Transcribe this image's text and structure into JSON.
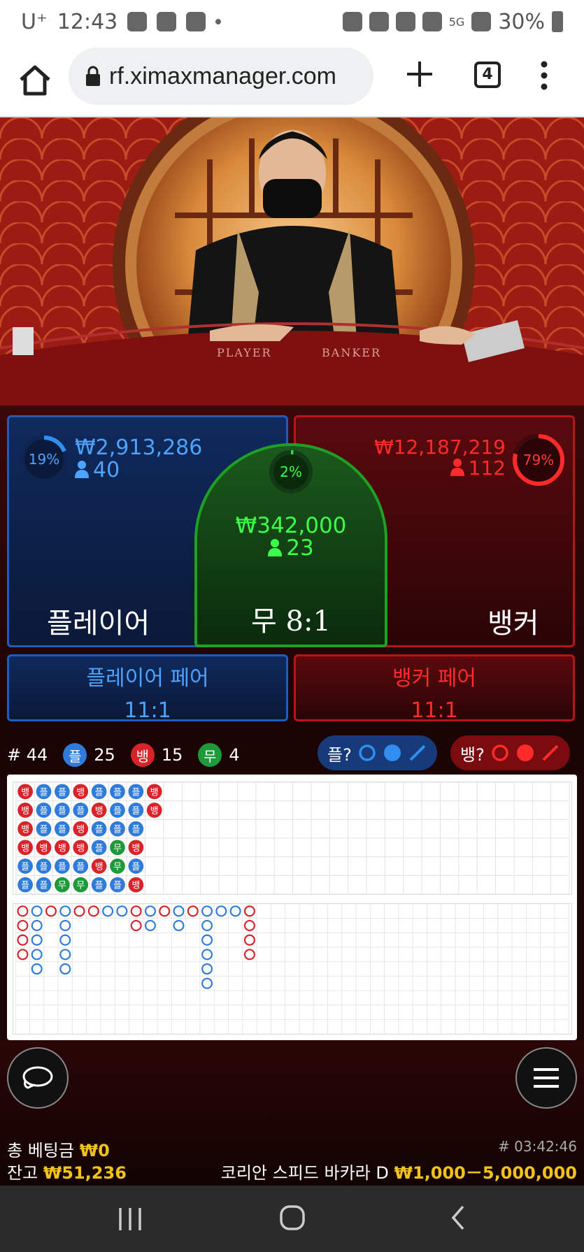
{
  "status_bar": {
    "carrier": "U⁺",
    "time": "12:43",
    "network": "5G",
    "battery": "30%"
  },
  "browser": {
    "url": "rf.ximaxmanager.com",
    "tab_count": "4"
  },
  "video": {
    "table_labels": [
      "PLAYER",
      "BANKER"
    ]
  },
  "bets": {
    "player": {
      "percent": "19%",
      "percent_value": 0.19,
      "amount": "₩2,913,286",
      "count": "40",
      "label": "플레이어"
    },
    "tie": {
      "percent": "2%",
      "percent_value": 0.02,
      "amount": "₩342,000",
      "count": "23",
      "label": "무 8:1"
    },
    "banker": {
      "percent": "79%",
      "percent_value": 0.79,
      "amount": "₩12,187,219",
      "count": "112",
      "label": "뱅커"
    },
    "player_pair": {
      "label": "플레이어 페어",
      "odds": "11:1"
    },
    "banker_pair": {
      "label": "뱅커 페어",
      "odds": "11:1"
    }
  },
  "summary": {
    "round": "# 44",
    "player_label": "플",
    "player_count": "25",
    "banker_label": "뱅",
    "banker_count": "15",
    "tie_label": "무",
    "tie_count": "4",
    "player_predict": "플?",
    "banker_predict": "뱅?"
  },
  "bead_road": [
    [
      "뱅",
      "플",
      "플",
      "뱅",
      "플",
      "플",
      "플",
      "뱅"
    ],
    [
      "뱅",
      "플",
      "플",
      "플",
      "뱅",
      "플",
      "플",
      "뱅"
    ],
    [
      "뱅",
      "플",
      "플",
      "뱅",
      "플",
      "플",
      "플"
    ],
    [
      "뱅",
      "뱅",
      "뱅",
      "뱅",
      "플",
      "무",
      "뱅"
    ],
    [
      "플",
      "플",
      "플",
      "플",
      "뱅",
      "무",
      "플"
    ],
    [
      "플",
      "플",
      "무",
      "무",
      "플",
      "플",
      "뱅"
    ]
  ],
  "colors": {
    "player": "#2f7bdc",
    "banker": "#d8232a",
    "tie": "#1f9a3a",
    "gold": "#f2c21a"
  },
  "bottom": {
    "total_bet_label": "총 베팅금",
    "total_bet": "₩0",
    "balance_label": "잔고",
    "balance": "₩51,236",
    "round_id": "# 03:42:46",
    "table_name": "코리안 스피드 바카라 D",
    "limits": "₩1,000－5,000,000"
  }
}
